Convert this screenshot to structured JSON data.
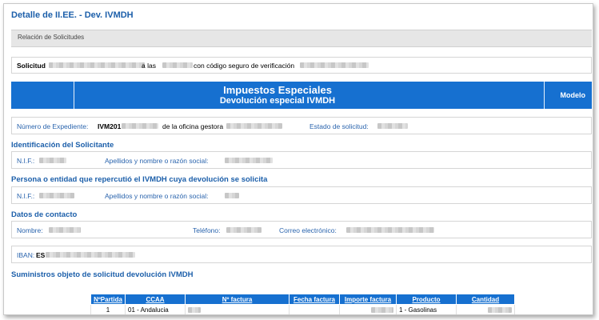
{
  "page": {
    "title": "Detalle de II.EE. - Dev. IVMDH",
    "section": "Relación de Solicitudes"
  },
  "solicitud": {
    "label": "Solicitud",
    "mid_text": "a las",
    "code_text": "con código seguro de verificación"
  },
  "header": {
    "title": "Impuestos Especiales",
    "subtitle": "Devolución especial IVMDH",
    "model_label": "Modelo"
  },
  "expediente": {
    "num_label": "Número de Expediente:",
    "num_prefix": "IVM201",
    "office_text": "de la oficina gestora",
    "state_label": "Estado de solicitud:"
  },
  "solicitante": {
    "heading": "Identificación del Solicitante",
    "nif_label": "N.I.F.:",
    "name_label": "Apellidos y nombre o razón social:"
  },
  "repercute": {
    "heading": "Persona o entidad que repercutió el IVMDH cuya devolución se solicita",
    "nif_label": "N.I.F.:",
    "name_label": "Apellidos y nombre o razón social:"
  },
  "contacto": {
    "heading": "Datos de contacto",
    "name_label": "Nombre:",
    "phone_label": "Teléfono:",
    "email_label": "Correo electrónico:"
  },
  "iban": {
    "label": "IBAN:",
    "prefix": "ES"
  },
  "suministros": {
    "heading": "Suministros objeto de solicitud devolución IVMDH",
    "columns": [
      "NºPartida",
      "CCAA",
      "Nº factura",
      "Fecha factura",
      "Importe factura",
      "Producto",
      "Cantidad"
    ],
    "rows": [
      [
        "1",
        "01 - Andalucia",
        "",
        "",
        "",
        "1 - Gasolinas",
        ""
      ]
    ]
  },
  "colors": {
    "accent": "#1670d0",
    "label_blue": "#2a64ad"
  }
}
